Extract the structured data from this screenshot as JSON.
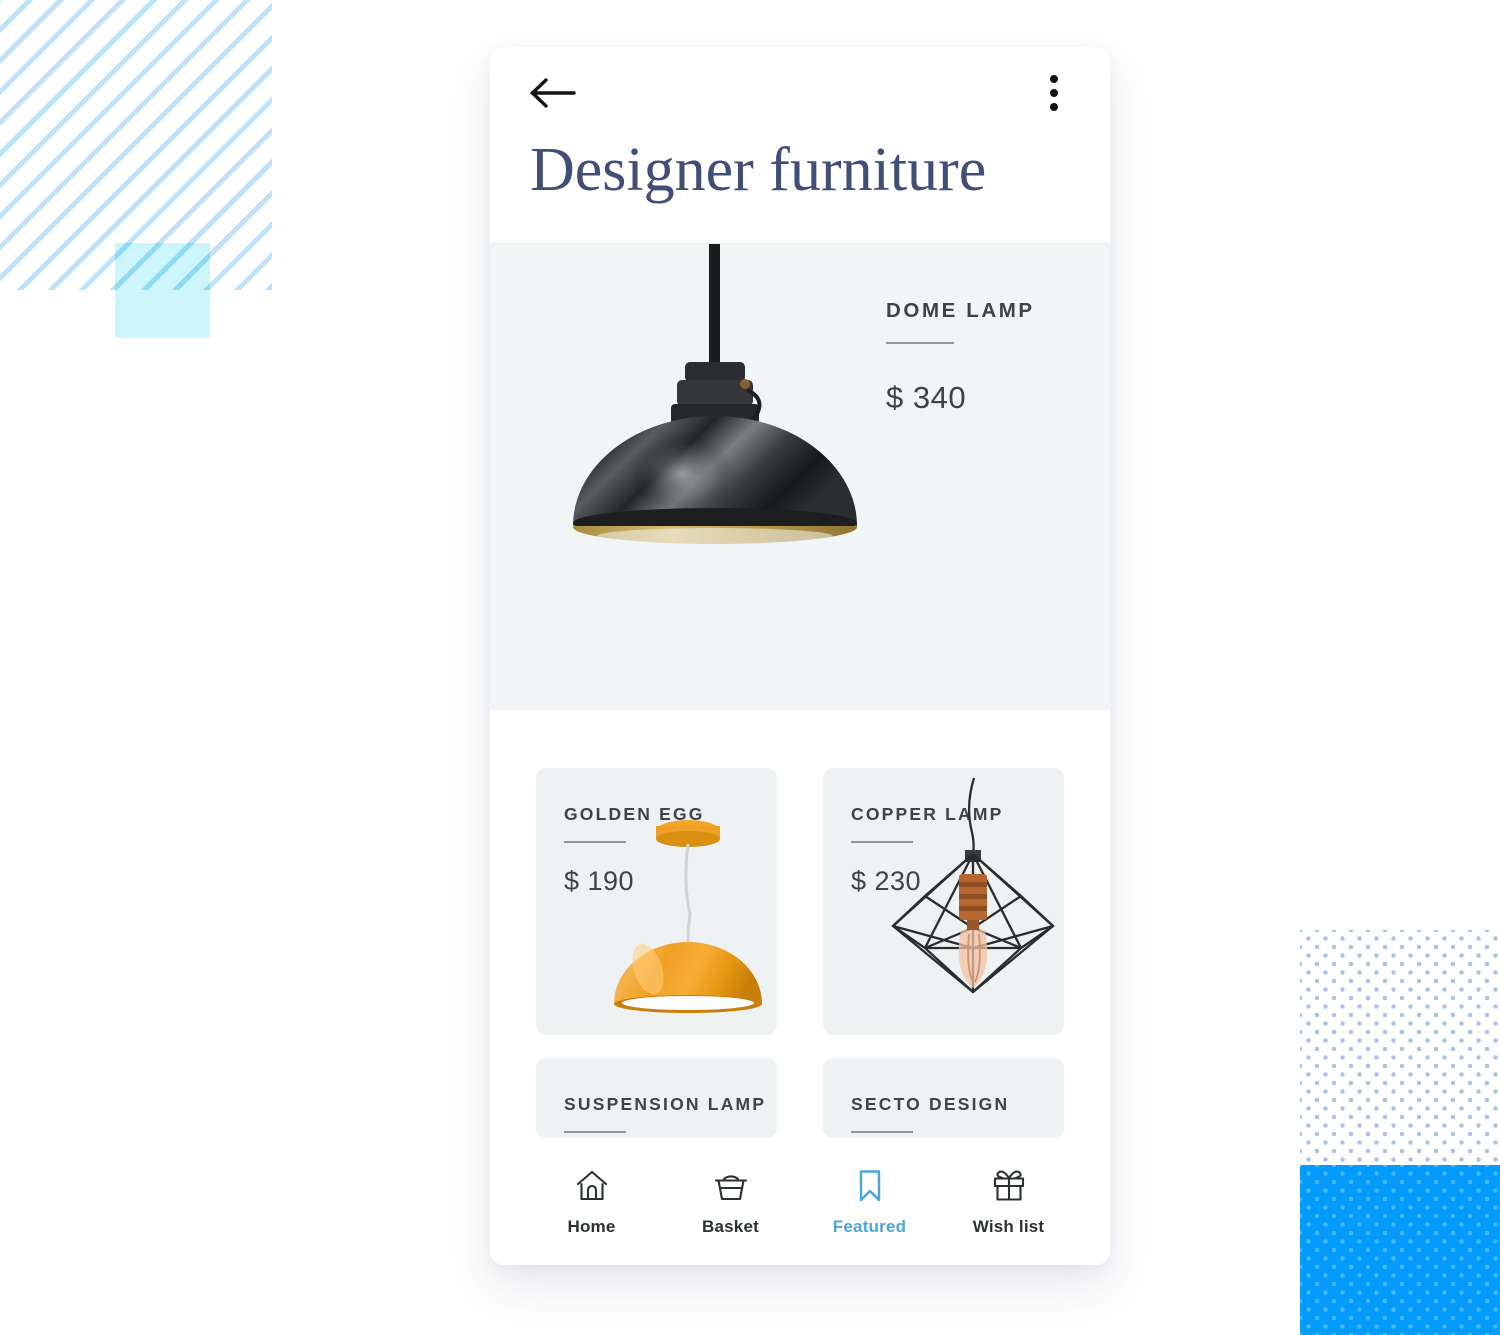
{
  "theme": {
    "accent_blue": "#4BA5DA",
    "title_navy": "#414E78",
    "text_dark": "#3D4347",
    "hero_bg": "#F1F5F6",
    "card_bg": "#EEF2F3",
    "deco_blue_square": "#039BFC",
    "deco_cyan_square": "#CCF5FC",
    "deco_stripe_blue": "#BFE2F8",
    "deco_dot_blue": "#AEC0E8"
  },
  "topbar": {
    "back_icon": "arrow-left-icon",
    "menu_icon": "overflow-menu-icon"
  },
  "header": {
    "title": "Designer furniture"
  },
  "hero": {
    "product_name": "DOME LAMP",
    "price": "$ 340",
    "image_alt": "black dome pendant lamp with brass interior"
  },
  "products": [
    {
      "name": "GOLDEN EGG",
      "price": "$ 190",
      "art": "golden-egg-lamp"
    },
    {
      "name": "COPPER LAMP",
      "price": "$ 230",
      "art": "copper-cage-lamp"
    },
    {
      "name": "SUSPENSION LAMP",
      "price": "",
      "art": "suspension-lamp"
    },
    {
      "name": "SECTO DESIGN",
      "price": "",
      "art": "secto-design-lamp"
    }
  ],
  "nav": {
    "items": [
      {
        "label": "Home",
        "icon": "home-icon",
        "active": false
      },
      {
        "label": "Basket",
        "icon": "basket-icon",
        "active": false
      },
      {
        "label": "Featured",
        "icon": "bookmark-icon",
        "active": true
      },
      {
        "label": "Wish list",
        "icon": "gift-icon",
        "active": false
      }
    ]
  }
}
